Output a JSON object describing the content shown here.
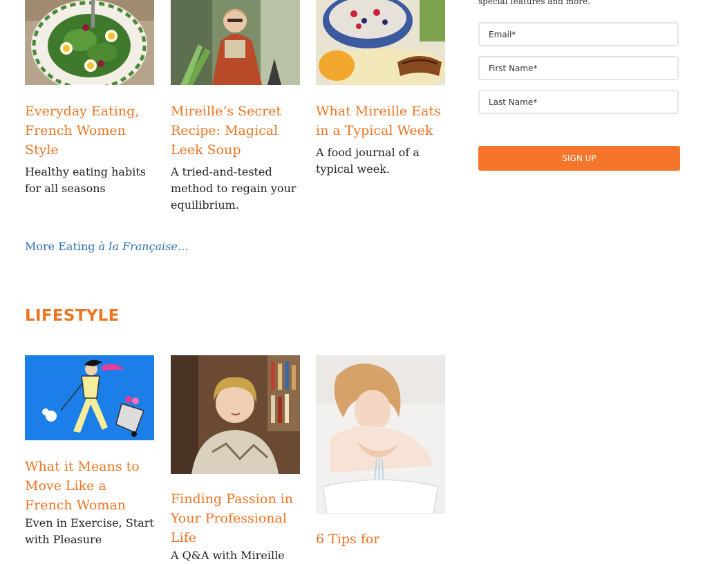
{
  "eating": {
    "cards": [
      {
        "title": "Everyday Eating, French Women Style",
        "description": "Healthy eating habits for all seasons"
      },
      {
        "title": "Mireille’s Secret Recipe: Magical Leek Soup",
        "description": "A tried-and-tested method to regain your equilibrium."
      },
      {
        "title": "What Mireille Eats in a Typical Week",
        "description": "A food journal of a typical week."
      }
    ],
    "more_link": {
      "prefix": "More Eating ",
      "emphasis": "à la Française",
      "suffix": "…"
    }
  },
  "lifestyle": {
    "heading": "LIFESTYLE",
    "cards": [
      {
        "title": "What it Means to Move Like a French Woman",
        "description": "Even in Exercise, Start with Pleasure"
      },
      {
        "title": "Finding Passion in Your Professional Life",
        "description": "A Q&A with Mireille"
      },
      {
        "title": "6 Tips for",
        "description": ""
      }
    ]
  },
  "signup": {
    "intro": "special features and more.",
    "email_placeholder": "Email*",
    "first_name_placeholder": "First Name*",
    "last_name_placeholder": "Last Name*",
    "button_label": "SIGN UP"
  },
  "colors": {
    "accent": "#ee7422",
    "link": "#2c6fb5",
    "button": "#f5752a"
  }
}
